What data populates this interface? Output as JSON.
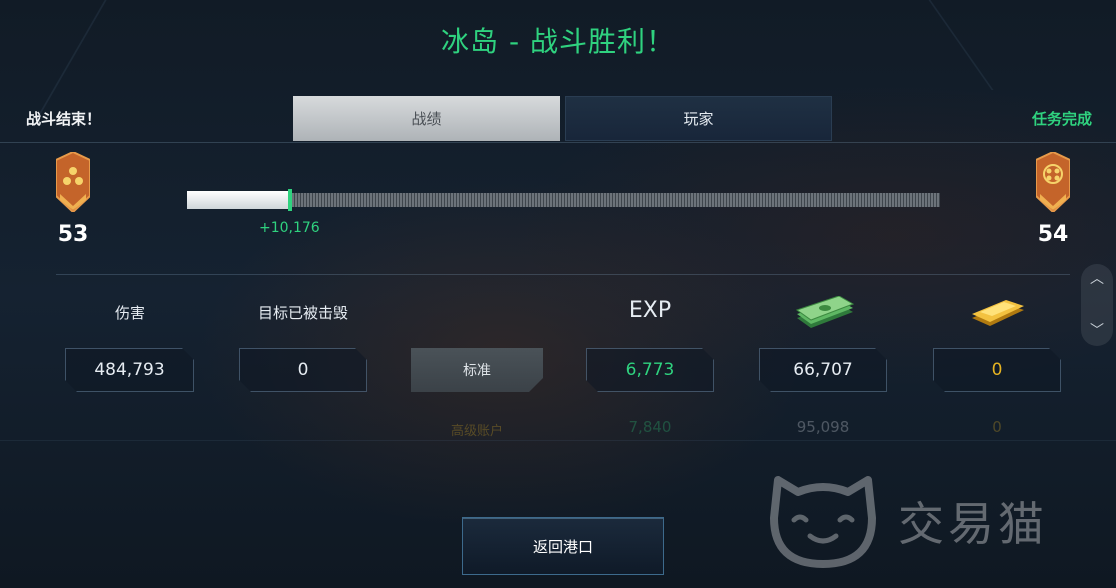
{
  "header": {
    "title": "冰岛 - 战斗胜利！"
  },
  "status": {
    "left": "战斗结束！",
    "right": "任务完成"
  },
  "tabs": [
    {
      "label": "战绩",
      "active": true
    },
    {
      "label": "玩家",
      "active": false
    }
  ],
  "progress": {
    "current_level": "53",
    "next_level": "54",
    "gain_text": "+10,176",
    "fill_fraction": 0.137
  },
  "stats": {
    "headers": {
      "damage": "伤害",
      "destroyed": "目标已被击毁",
      "exp": "EXP"
    },
    "damage_value": "484,793",
    "destroyed_value": "0",
    "rows": [
      {
        "label": "标准",
        "exp": "6,773",
        "credits": "66,707",
        "gold": "0"
      },
      {
        "label": "高级账户",
        "exp": "7,840",
        "credits": "95,098",
        "gold": "0"
      }
    ]
  },
  "icons": {
    "credits": "cash-icon",
    "gold": "gold-bar-icon",
    "rank": "rank-insignia-icon"
  },
  "colors": {
    "accent_green": "#2fd27f",
    "gold": "#e6b422",
    "tab_active": "#c8cccf"
  },
  "actions": {
    "return_label": "返回港口"
  },
  "watermark": {
    "text": "交易猫"
  }
}
